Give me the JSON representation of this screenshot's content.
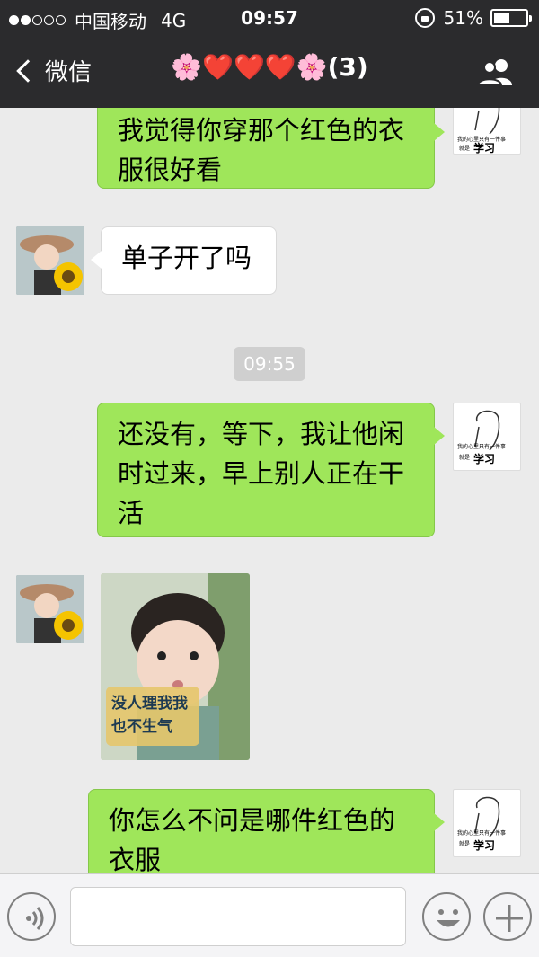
{
  "status_bar": {
    "carrier": "中国移动",
    "network": "4G",
    "time": "09:57",
    "battery_percent_label": "51%",
    "battery_level": 0.51
  },
  "nav": {
    "back_label": "微信",
    "chat_title": "🌸❤️❤️❤️🌸(3)"
  },
  "messages": {
    "m1_text": "我觉得你穿那个红色的衣服很好看",
    "m2_text": "单子开了吗",
    "timestamp": "09:55",
    "m3_text": "还没有，等下，我让他闲时过来，早上别人正在干活",
    "m4_sticker_text_1": "没人理我我",
    "m4_sticker_text_2": "也不生气",
    "m5_text": "你怎么不问是哪件红色的衣服"
  },
  "my_avatar": {
    "line1": "我的心里只有一件事",
    "line2_prefix": "就是",
    "line2_big": "学习"
  },
  "bottom_bar": {
    "input_placeholder": ""
  },
  "colors": {
    "header": "#2b2b2d",
    "sent_bubble": "#9fe65a",
    "received_bubble": "#ffffff",
    "background": "#ebebeb"
  }
}
